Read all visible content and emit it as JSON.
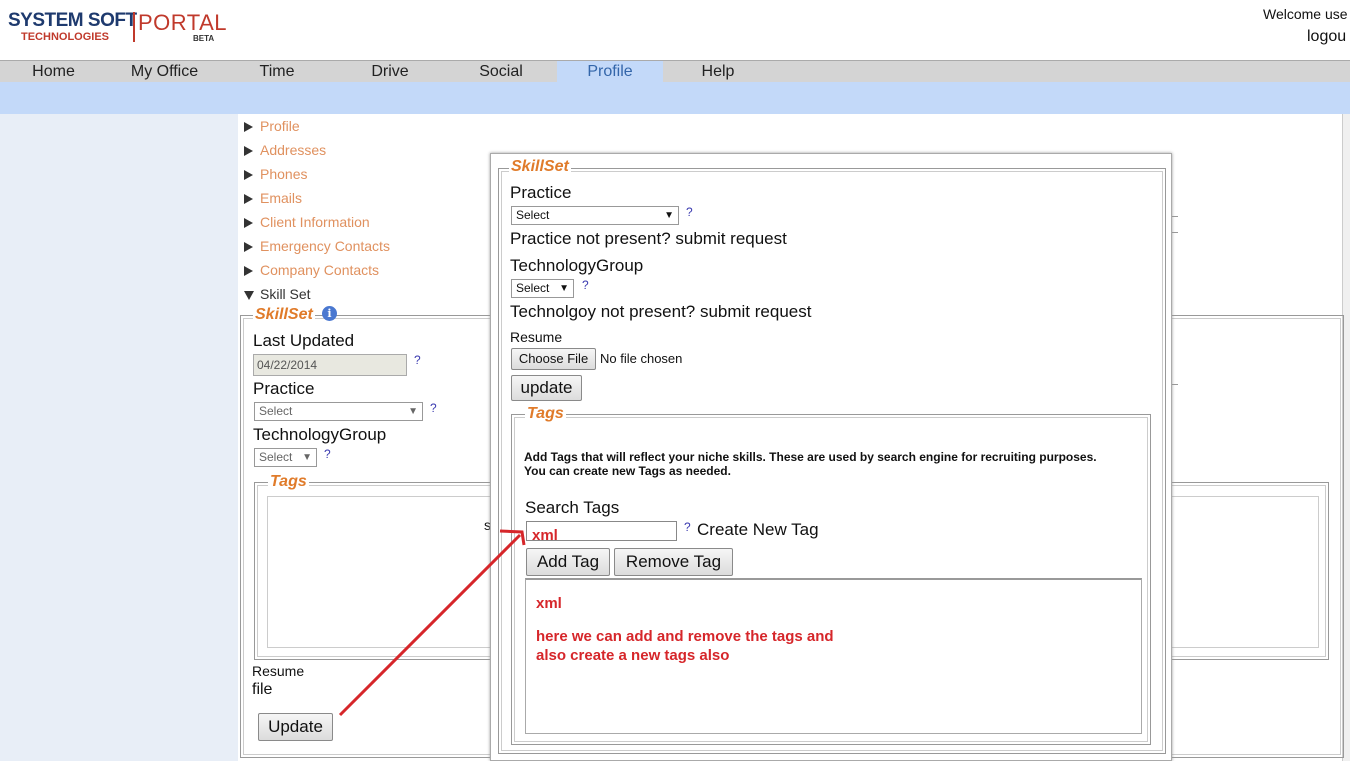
{
  "header": {
    "logo_main": "SYSTEM SOFT",
    "logo_sub": "TECHNOLOGIES",
    "logo_portal": "PORTAL",
    "logo_beta": "BETA",
    "welcome": "Welcome use",
    "logout": "logou"
  },
  "nav": [
    "Home",
    "My Office",
    "Time",
    "Drive",
    "Social",
    "Profile",
    "Help"
  ],
  "nav_active": "Profile",
  "side_menu": [
    "Profile",
    "Addresses",
    "Phones",
    "Emails",
    "Client Information",
    "Emergency Contacts",
    "Company Contacts",
    "Skill Set"
  ],
  "back_form": {
    "legend": "SkillSet",
    "last_updated_label": "Last Updated",
    "last_updated_value": "04/22/2014",
    "practice_label": "Practice",
    "practice_value": "Select",
    "tech_label": "TechnologyGroup",
    "tech_value": "Select",
    "tags_legend": "Tags",
    "tags_fragment": "s",
    "resume_label": "Resume",
    "resume_value": "file",
    "update_button": "Update"
  },
  "popup": {
    "legend": "SkillSet",
    "practice_label": "Practice",
    "practice_value": "Select",
    "practice_missing": "Practice not present? submit request",
    "tech_label": "TechnologyGroup",
    "tech_value": "Select",
    "tech_missing": "Technolgoy not present? submit request",
    "resume_label": "Resume",
    "choose_file": "Choose File",
    "no_file": "No file chosen",
    "update_button": "update",
    "tags": {
      "legend": "Tags",
      "help_line1": "Add Tags that will reflect your niche skills. These are used by search engine for recruiting purposes.",
      "help_line2": "You can create new Tags as needed.",
      "search_label": "Search Tags",
      "search_value": "xml",
      "create_new": "Create New Tag",
      "add_button": "Add Tag",
      "remove_button": "Remove Tag",
      "list_item": "xml",
      "note_line1": "here we can add and remove the tags and",
      "note_line2": "also create a new tags also"
    }
  },
  "help_mark": "?",
  "colors": {
    "nav_active_bg": "#c3d9f9",
    "menu_link": "#e0915f",
    "legend": "#e07b2a",
    "annotation": "#d6262a"
  }
}
